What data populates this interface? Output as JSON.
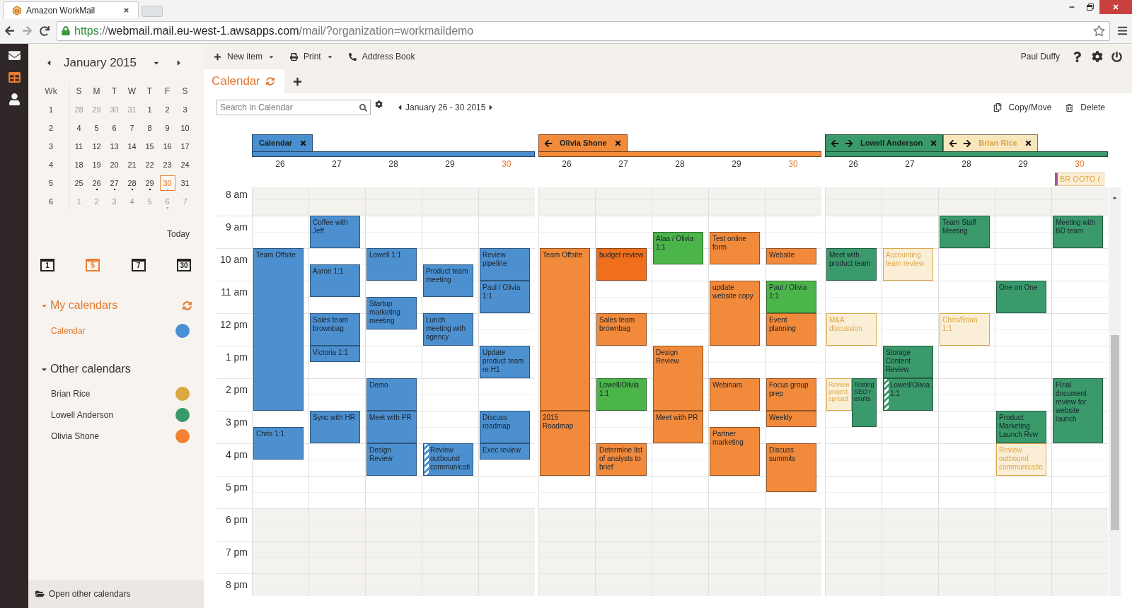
{
  "browser": {
    "tab_title": "Amazon WorkMail",
    "url": {
      "scheme": "https",
      "separator": "://",
      "host": "webmail.mail.eu-west-1.awsapps.com",
      "path": "/mail/?organization=workmaildemo"
    }
  },
  "rail": [
    {
      "selected": false
    },
    {
      "selected": true
    },
    {
      "selected": false
    }
  ],
  "mini_calendar": {
    "title": "January 2015",
    "week_heading": "Wk",
    "weekdays": [
      "S",
      "M",
      "T",
      "W",
      "T",
      "F",
      "S"
    ],
    "weeks": [
      {
        "number": "1",
        "days": [
          {
            "label": "28",
            "muted": true,
            "dot": false,
            "today": false
          },
          {
            "label": "29",
            "muted": true,
            "dot": false,
            "today": false
          },
          {
            "label": "30",
            "muted": true,
            "dot": false,
            "today": false
          },
          {
            "label": "31",
            "muted": true,
            "dot": false,
            "today": false
          },
          {
            "label": "1",
            "muted": false,
            "dot": false,
            "today": false
          },
          {
            "label": "2",
            "muted": false,
            "dot": false,
            "today": false
          },
          {
            "label": "3",
            "muted": false,
            "dot": false,
            "today": false
          }
        ]
      },
      {
        "number": "2",
        "days": [
          {
            "label": "4",
            "muted": false,
            "dot": false,
            "today": false
          },
          {
            "label": "5",
            "muted": false,
            "dot": false,
            "today": false
          },
          {
            "label": "6",
            "muted": false,
            "dot": false,
            "today": false
          },
          {
            "label": "7",
            "muted": false,
            "dot": false,
            "today": false
          },
          {
            "label": "8",
            "muted": false,
            "dot": false,
            "today": false
          },
          {
            "label": "9",
            "muted": false,
            "dot": false,
            "today": false
          },
          {
            "label": "10",
            "muted": false,
            "dot": false,
            "today": false
          }
        ]
      },
      {
        "number": "3",
        "days": [
          {
            "label": "11",
            "muted": false,
            "dot": false,
            "today": false
          },
          {
            "label": "12",
            "muted": false,
            "dot": false,
            "today": false
          },
          {
            "label": "13",
            "muted": false,
            "dot": false,
            "today": false
          },
          {
            "label": "14",
            "muted": false,
            "dot": false,
            "today": false
          },
          {
            "label": "15",
            "muted": false,
            "dot": false,
            "today": false
          },
          {
            "label": "16",
            "muted": false,
            "dot": false,
            "today": false
          },
          {
            "label": "17",
            "muted": false,
            "dot": false,
            "today": false
          }
        ]
      },
      {
        "number": "4",
        "days": [
          {
            "label": "18",
            "muted": false,
            "dot": false,
            "today": false
          },
          {
            "label": "19",
            "muted": false,
            "dot": false,
            "today": false
          },
          {
            "label": "20",
            "muted": false,
            "dot": false,
            "today": false
          },
          {
            "label": "21",
            "muted": false,
            "dot": false,
            "today": false
          },
          {
            "label": "22",
            "muted": false,
            "dot": false,
            "today": false
          },
          {
            "label": "23",
            "muted": false,
            "dot": false,
            "today": false
          },
          {
            "label": "24",
            "muted": false,
            "dot": false,
            "today": false
          }
        ]
      },
      {
        "number": "5",
        "days": [
          {
            "label": "25",
            "muted": false,
            "dot": false,
            "today": false
          },
          {
            "label": "26",
            "muted": false,
            "dot": true,
            "today": false
          },
          {
            "label": "27",
            "muted": false,
            "dot": true,
            "today": false
          },
          {
            "label": "28",
            "muted": false,
            "dot": true,
            "today": false
          },
          {
            "label": "29",
            "muted": false,
            "dot": true,
            "today": false
          },
          {
            "label": "30",
            "muted": false,
            "dot": true,
            "today": true
          },
          {
            "label": "31",
            "muted": false,
            "dot": false,
            "today": false
          }
        ]
      },
      {
        "number": "6",
        "days": [
          {
            "label": "1",
            "muted": true,
            "dot": false,
            "today": false
          },
          {
            "label": "2",
            "muted": true,
            "dot": false,
            "today": false
          },
          {
            "label": "3",
            "muted": true,
            "dot": false,
            "today": false
          },
          {
            "label": "4",
            "muted": true,
            "dot": false,
            "today": false
          },
          {
            "label": "5",
            "muted": true,
            "dot": false,
            "today": false
          },
          {
            "label": "6",
            "muted": true,
            "dot": true,
            "today": false
          },
          {
            "label": "7",
            "muted": true,
            "dot": false,
            "today": false
          }
        ]
      }
    ]
  },
  "today_link": "Today",
  "views": [
    {
      "label": "1",
      "selected": false
    },
    {
      "label": "5",
      "selected": true
    },
    {
      "label": "7",
      "selected": false
    },
    {
      "label": "30",
      "selected": false
    }
  ],
  "my_calendars": {
    "title": "My calendars",
    "expanded": true,
    "items": [
      {
        "name": "Calendar",
        "color": "#4a90d4",
        "selected": true
      }
    ]
  },
  "other_calendars": {
    "title": "Other calendars",
    "expanded": true,
    "items": [
      {
        "name": "Brian Rice",
        "color": "#d9a83e",
        "selected": false
      },
      {
        "name": "Lowell Anderson",
        "color": "#38996a",
        "selected": false
      },
      {
        "name": "Olivia Shone",
        "color": "#f58232",
        "selected": false
      }
    ]
  },
  "open_other": "Open other calendars",
  "toolbar": [
    {
      "label": "New item",
      "dropdown": true
    },
    {
      "label": "Print",
      "dropdown": true
    },
    {
      "label": "Address Book",
      "dropdown": false
    }
  ],
  "user": "Paul Duffy",
  "view_tab": "Calendar",
  "search": {
    "placeholder": "Search in Calendar"
  },
  "date_range": "January 26 - 30 2015",
  "actions": [
    "Copy/Move",
    "Delete"
  ],
  "hours": [
    "8 am",
    "9 am",
    "10 am",
    "11 am",
    "12 pm",
    "1 pm",
    "2 pm",
    "3 pm",
    "4 pm",
    "5 pm",
    "6 pm",
    "7 pm",
    "8 pm"
  ],
  "groups": [
    {
      "color": "#4a8fd0",
      "tabs": [
        {
          "name": "Calendar",
          "kind": "plain",
          "color": "#4a8fd0"
        }
      ],
      "days": [
        {
          "label": "26",
          "today": false,
          "slots": [
            {
              "kind": "off"
            },
            {
              "kind": "off"
            },
            {
              "kind": "open"
            },
            {
              "kind": "open"
            },
            {
              "kind": "busy",
              "title": "Team Offsite",
              "color": "#4d90d0"
            },
            {
              "kind": "continued"
            },
            {
              "kind": "continued"
            },
            {
              "kind": "continued"
            },
            {
              "kind": "continued"
            },
            {
              "kind": "continued"
            },
            {
              "kind": "continued"
            },
            {
              "kind": "continued"
            },
            {
              "kind": "continued"
            },
            {
              "kind": "continued"
            },
            {
              "kind": "open"
            },
            {
              "kind": "busy",
              "title": "Chris 1:1",
              "color": "#4d90d0"
            },
            {
              "kind": "continued"
            },
            {
              "kind": "open"
            },
            {
              "kind": "open"
            },
            {
              "kind": "open"
            },
            {
              "kind": "off"
            },
            {
              "kind": "off"
            },
            {
              "kind": "off"
            },
            {
              "kind": "off"
            },
            {
              "kind": "off"
            },
            {
              "kind": "off"
            }
          ]
        },
        {
          "label": "27",
          "today": false,
          "slots": [
            {
              "kind": "off"
            },
            {
              "kind": "off"
            },
            {
              "kind": "busy",
              "title": "Coffee with Jeff",
              "color": "#4d90d0"
            },
            {
              "kind": "continued"
            },
            {
              "kind": "open"
            },
            {
              "kind": "busy",
              "title": "Aaron 1:1",
              "color": "#4d90d0"
            },
            {
              "kind": "continued"
            },
            {
              "kind": "open"
            },
            {
              "kind": "busy",
              "title": "Sales team brownbag",
              "color": "#4d90d0"
            },
            {
              "kind": "continued"
            },
            {
              "kind": "busy",
              "title": "Victoria 1:1",
              "color": "#4d90d0"
            },
            {
              "kind": "open"
            },
            {
              "kind": "open"
            },
            {
              "kind": "open"
            },
            {
              "kind": "busy",
              "title": "Sync with HR",
              "color": "#4d90d0"
            },
            {
              "kind": "continued"
            },
            {
              "kind": "open"
            },
            {
              "kind": "open"
            },
            {
              "kind": "open"
            },
            {
              "kind": "open"
            },
            {
              "kind": "off"
            },
            {
              "kind": "off"
            },
            {
              "kind": "off"
            },
            {
              "kind": "off"
            },
            {
              "kind": "off"
            },
            {
              "kind": "off"
            }
          ]
        },
        {
          "label": "28",
          "today": false,
          "slots": [
            {
              "kind": "off"
            },
            {
              "kind": "off"
            },
            {
              "kind": "open"
            },
            {
              "kind": "open"
            },
            {
              "kind": "busy",
              "title": "Lowell 1:1",
              "color": "#4d90d0"
            },
            {
              "kind": "continued"
            },
            {
              "kind": "open"
            },
            {
              "kind": "busy",
              "title": "Startup marketing meeting",
              "color": "#4d90d0"
            },
            {
              "kind": "continued"
            },
            {
              "kind": "open"
            },
            {
              "kind": "open"
            },
            {
              "kind": "open"
            },
            {
              "kind": "busy",
              "title": "Demo",
              "color": "#4d90d0"
            },
            {
              "kind": "continued"
            },
            {
              "kind": "busy",
              "title": "Meet with PR",
              "color": "#4d90d0"
            },
            {
              "kind": "continued"
            },
            {
              "kind": "busy",
              "title": "Design Review",
              "color": "#4d90d0"
            },
            {
              "kind": "continued"
            },
            {
              "kind": "open"
            },
            {
              "kind": "open"
            },
            {
              "kind": "off"
            },
            {
              "kind": "off"
            },
            {
              "kind": "off"
            },
            {
              "kind": "off"
            },
            {
              "kind": "off"
            },
            {
              "kind": "off"
            }
          ]
        },
        {
          "label": "29",
          "today": false,
          "slots": [
            {
              "kind": "off"
            },
            {
              "kind": "off"
            },
            {
              "kind": "open"
            },
            {
              "kind": "open"
            },
            {
              "kind": "open"
            },
            {
              "kind": "busy",
              "title": "Product team meeting",
              "color": "#4d90d0"
            },
            {
              "kind": "continued"
            },
            {
              "kind": "open"
            },
            {
              "kind": "busy",
              "title": "Lunch meeting with agency",
              "color": "#4d90d0"
            },
            {
              "kind": "continued"
            },
            {
              "kind": "open"
            },
            {
              "kind": "open"
            },
            {
              "kind": "open"
            },
            {
              "kind": "open"
            },
            {
              "kind": "open"
            },
            {
              "kind": "open"
            },
            {
              "kind": "hatched",
              "title": "Review outbound communicati",
              "color": "#4d90d0"
            },
            {
              "kind": "continued"
            },
            {
              "kind": "open"
            },
            {
              "kind": "open"
            },
            {
              "kind": "off"
            },
            {
              "kind": "off"
            },
            {
              "kind": "off"
            },
            {
              "kind": "off"
            },
            {
              "kind": "off"
            },
            {
              "kind": "off"
            }
          ]
        },
        {
          "label": "30",
          "today": true,
          "slots": [
            {
              "kind": "off"
            },
            {
              "kind": "off"
            },
            {
              "kind": "open"
            },
            {
              "kind": "open"
            },
            {
              "kind": "busy",
              "title": "Review pipeline",
              "color": "#4d90d0"
            },
            {
              "kind": "continued"
            },
            {
              "kind": "busy",
              "title": "Paul / Olivia 1:1",
              "color": "#4d90d0"
            },
            {
              "kind": "continued"
            },
            {
              "kind": "open"
            },
            {
              "kind": "open"
            },
            {
              "kind": "busy",
              "title": "Update product team re:H1",
              "color": "#4d90d0"
            },
            {
              "kind": "continued"
            },
            {
              "kind": "open"
            },
            {
              "kind": "open"
            },
            {
              "kind": "busy",
              "title": "Discuss roadmap",
              "color": "#4d90d0"
            },
            {
              "kind": "continued"
            },
            {
              "kind": "busy",
              "title": "Exec review",
              "color": "#4d90d0"
            },
            {
              "kind": "open"
            },
            {
              "kind": "open"
            },
            {
              "kind": "open"
            },
            {
              "kind": "off"
            },
            {
              "kind": "off"
            },
            {
              "kind": "off"
            },
            {
              "kind": "off"
            },
            {
              "kind": "off"
            },
            {
              "kind": "off"
            }
          ]
        }
      ]
    },
    {
      "color": "#f28a3c",
      "tabs": [
        {
          "name": "Olivia Shone",
          "kind": "back",
          "color": "#f28a3c"
        }
      ],
      "days": [
        {
          "label": "26",
          "today": false,
          "slots": [
            {
              "kind": "off"
            },
            {
              "kind": "off"
            },
            {
              "kind": "open"
            },
            {
              "kind": "open"
            },
            {
              "kind": "busy",
              "title": "Team Offsite",
              "color": "#f28a3c"
            },
            {
              "kind": "continued"
            },
            {
              "kind": "continued"
            },
            {
              "kind": "continued"
            },
            {
              "kind": "continued"
            },
            {
              "kind": "continued"
            },
            {
              "kind": "continued"
            },
            {
              "kind": "continued"
            },
            {
              "kind": "continued"
            },
            {
              "kind": "continued"
            },
            {
              "kind": "busy",
              "title": "2015 Roadmap",
              "color": "#f28a3c"
            },
            {
              "kind": "continued"
            },
            {
              "kind": "continued"
            },
            {
              "kind": "continued"
            },
            {
              "kind": "open"
            },
            {
              "kind": "open"
            },
            {
              "kind": "off"
            },
            {
              "kind": "off"
            },
            {
              "kind": "off"
            },
            {
              "kind": "off"
            },
            {
              "kind": "off"
            },
            {
              "kind": "off"
            }
          ]
        },
        {
          "label": "27",
          "today": false,
          "slots": [
            {
              "kind": "off"
            },
            {
              "kind": "off"
            },
            {
              "kind": "open"
            },
            {
              "kind": "open"
            },
            {
              "kind": "busy",
              "title": "budget review",
              "color": "#ef6f1c"
            },
            {
              "kind": "continued"
            },
            {
              "kind": "open"
            },
            {
              "kind": "open"
            },
            {
              "kind": "busy",
              "title": "Sales team brownbag",
              "color": "#f28a3c"
            },
            {
              "kind": "continued"
            },
            {
              "kind": "open"
            },
            {
              "kind": "open"
            },
            {
              "kind": "busy",
              "title": "Lowell/Olivia 1:1",
              "color": "#4cb54a"
            },
            {
              "kind": "continued"
            },
            {
              "kind": "open"
            },
            {
              "kind": "open"
            },
            {
              "kind": "busy",
              "title": "Determine list of analysts to brief",
              "color": "#f28a3c"
            },
            {
              "kind": "continued"
            },
            {
              "kind": "open"
            },
            {
              "kind": "open"
            },
            {
              "kind": "off"
            },
            {
              "kind": "off"
            },
            {
              "kind": "off"
            },
            {
              "kind": "off"
            },
            {
              "kind": "off"
            },
            {
              "kind": "off"
            }
          ]
        },
        {
          "label": "28",
          "today": false,
          "slots": [
            {
              "kind": "off"
            },
            {
              "kind": "off"
            },
            {
              "kind": "open"
            },
            {
              "kind": "busy",
              "title": "Alaa / Olivia 1:1",
              "color": "#4cb54a"
            },
            {
              "kind": "continued"
            },
            {
              "kind": "open"
            },
            {
              "kind": "open"
            },
            {
              "kind": "open"
            },
            {
              "kind": "open"
            },
            {
              "kind": "open"
            },
            {
              "kind": "busy",
              "title": "Design Review",
              "color": "#f28a3c"
            },
            {
              "kind": "continued"
            },
            {
              "kind": "continued"
            },
            {
              "kind": "continued"
            },
            {
              "kind": "busy",
              "title": "Meet with PR",
              "color": "#f28a3c"
            },
            {
              "kind": "continued"
            },
            {
              "kind": "open"
            },
            {
              "kind": "open"
            },
            {
              "kind": "open"
            },
            {
              "kind": "open"
            },
            {
              "kind": "off"
            },
            {
              "kind": "off"
            },
            {
              "kind": "off"
            },
            {
              "kind": "off"
            },
            {
              "kind": "off"
            },
            {
              "kind": "off"
            }
          ]
        },
        {
          "label": "29",
          "today": false,
          "slots": [
            {
              "kind": "off"
            },
            {
              "kind": "off"
            },
            {
              "kind": "open"
            },
            {
              "kind": "busy",
              "title": "Test online form",
              "color": "#f28a3c"
            },
            {
              "kind": "continued"
            },
            {
              "kind": "open"
            },
            {
              "kind": "busy",
              "title": "update website copy",
              "color": "#f28a3c"
            },
            {
              "kind": "continued"
            },
            {
              "kind": "continued"
            },
            {
              "kind": "continued"
            },
            {
              "kind": "open"
            },
            {
              "kind": "open"
            },
            {
              "kind": "busy",
              "title": "Webinars",
              "color": "#f28a3c"
            },
            {
              "kind": "continued"
            },
            {
              "kind": "open"
            },
            {
              "kind": "busy",
              "title": "Partner marketing",
              "color": "#f28a3c"
            },
            {
              "kind": "continued"
            },
            {
              "kind": "continued"
            },
            {
              "kind": "open"
            },
            {
              "kind": "open"
            },
            {
              "kind": "off"
            },
            {
              "kind": "off"
            },
            {
              "kind": "off"
            },
            {
              "kind": "off"
            },
            {
              "kind": "off"
            },
            {
              "kind": "off"
            }
          ]
        },
        {
          "label": "30",
          "today": true,
          "slots": [
            {
              "kind": "off"
            },
            {
              "kind": "off"
            },
            {
              "kind": "open"
            },
            {
              "kind": "open"
            },
            {
              "kind": "busy",
              "title": "Website",
              "color": "#f28a3c"
            },
            {
              "kind": "open"
            },
            {
              "kind": "busy",
              "title": "Paul / Olivia 1:1",
              "color": "#4cb54a"
            },
            {
              "kind": "continued"
            },
            {
              "kind": "busy",
              "title": "Event planning",
              "color": "#f28a3c"
            },
            {
              "kind": "continued"
            },
            {
              "kind": "open"
            },
            {
              "kind": "open"
            },
            {
              "kind": "busy",
              "title": "Focus group prep",
              "color": "#f28a3c"
            },
            {
              "kind": "continued"
            },
            {
              "kind": "busy",
              "title": "Weekly",
              "color": "#f28a3c"
            },
            {
              "kind": "open"
            },
            {
              "kind": "busy",
              "title": "Discuss summits",
              "color": "#f28a3c"
            },
            {
              "kind": "continued"
            },
            {
              "kind": "continued"
            },
            {
              "kind": "open"
            },
            {
              "kind": "off"
            },
            {
              "kind": "off"
            },
            {
              "kind": "off"
            },
            {
              "kind": "off"
            },
            {
              "kind": "off"
            },
            {
              "kind": "off"
            }
          ]
        }
      ]
    },
    {
      "color": "#3a9a6b",
      "tabs": [
        {
          "name": "Lowell Anderson",
          "kind": "movable",
          "color": "#3a9a6b"
        },
        {
          "name": "Brian Rice",
          "kind": "movable",
          "color": "#f8e6bd"
        }
      ],
      "days": [
        {
          "label": "26",
          "today": false,
          "slots": [
            {
              "kind": "off"
            },
            {
              "kind": "off"
            },
            {
              "kind": "open"
            },
            {
              "kind": "open"
            },
            {
              "kind": "busy",
              "title": "Meet with product team",
              "color": "#3a9a6b"
            },
            {
              "kind": "continued"
            },
            {
              "kind": "open"
            },
            {
              "kind": "open"
            },
            {
              "kind": "tentative",
              "title": "M&A discussion",
              "color": "#d9a84b"
            },
            {
              "kind": "continued"
            },
            {
              "kind": "open"
            },
            {
              "kind": "open"
            },
            {
              "kind": "split",
              "lanes": [
                {
                  "kind": "tentative",
                  "title": "Review project spread",
                  "color": "#d9a84b"
                },
                {
                  "kind": "busy",
                  "title": "Testing SEO results",
                  "color": "#3a9a6b"
                }
              ]
            },
            {
              "kind": "split",
              "lanes": [
                {
                  "kind": "continued"
                },
                {
                  "kind": "continued"
                }
              ]
            },
            {
              "kind": "split",
              "lanes": [
                {
                  "kind": "open"
                },
                {
                  "kind": "continued"
                }
              ]
            },
            {
              "kind": "open"
            },
            {
              "kind": "open"
            },
            {
              "kind": "open"
            },
            {
              "kind": "open"
            },
            {
              "kind": "open"
            },
            {
              "kind": "off"
            },
            {
              "kind": "off"
            },
            {
              "kind": "off"
            },
            {
              "kind": "off"
            },
            {
              "kind": "off"
            },
            {
              "kind": "off"
            }
          ]
        },
        {
          "label": "27",
          "today": false,
          "slots": [
            {
              "kind": "off"
            },
            {
              "kind": "off"
            },
            {
              "kind": "open"
            },
            {
              "kind": "open"
            },
            {
              "kind": "tentative",
              "title": "Accounting team review",
              "color": "#d9a84b"
            },
            {
              "kind": "continued"
            },
            {
              "kind": "open"
            },
            {
              "kind": "open"
            },
            {
              "kind": "open"
            },
            {
              "kind": "open"
            },
            {
              "kind": "busy",
              "title": "Storage Content Review",
              "color": "#3a9a6b"
            },
            {
              "kind": "continued"
            },
            {
              "kind": "hatched",
              "title": "Lowell/Olivia 1:1",
              "color": "#3a9a6b"
            },
            {
              "kind": "continued"
            },
            {
              "kind": "open"
            },
            {
              "kind": "open"
            },
            {
              "kind": "open"
            },
            {
              "kind": "open"
            },
            {
              "kind": "open"
            },
            {
              "kind": "open"
            },
            {
              "kind": "off"
            },
            {
              "kind": "off"
            },
            {
              "kind": "off"
            },
            {
              "kind": "off"
            },
            {
              "kind": "off"
            },
            {
              "kind": "off"
            }
          ]
        },
        {
          "label": "28",
          "today": false,
          "slots": [
            {
              "kind": "off"
            },
            {
              "kind": "off"
            },
            {
              "kind": "busy",
              "title": "Team Staff Meeting",
              "color": "#3a9a6b"
            },
            {
              "kind": "continued"
            },
            {
              "kind": "open"
            },
            {
              "kind": "open"
            },
            {
              "kind": "open"
            },
            {
              "kind": "open"
            },
            {
              "kind": "tentative",
              "title": "Chris/Brian 1:1",
              "color": "#d9a84b"
            },
            {
              "kind": "continued"
            },
            {
              "kind": "open"
            },
            {
              "kind": "open"
            },
            {
              "kind": "open"
            },
            {
              "kind": "open"
            },
            {
              "kind": "open"
            },
            {
              "kind": "open"
            },
            {
              "kind": "open"
            },
            {
              "kind": "open"
            },
            {
              "kind": "open"
            },
            {
              "kind": "open"
            },
            {
              "kind": "off"
            },
            {
              "kind": "off"
            },
            {
              "kind": "off"
            },
            {
              "kind": "off"
            },
            {
              "kind": "off"
            },
            {
              "kind": "off"
            }
          ]
        },
        {
          "label": "29",
          "today": false,
          "slots": [
            {
              "kind": "off"
            },
            {
              "kind": "off"
            },
            {
              "kind": "open"
            },
            {
              "kind": "open"
            },
            {
              "kind": "open"
            },
            {
              "kind": "open"
            },
            {
              "kind": "busy",
              "title": "One on One",
              "color": "#3a9a6b"
            },
            {
              "kind": "continued"
            },
            {
              "kind": "open"
            },
            {
              "kind": "open"
            },
            {
              "kind": "open"
            },
            {
              "kind": "open"
            },
            {
              "kind": "open"
            },
            {
              "kind": "open"
            },
            {
              "kind": "busy",
              "title": "Product Marketing Launch Rvw",
              "color": "#3a9a6b"
            },
            {
              "kind": "continued"
            },
            {
              "kind": "tentative",
              "title": "Review outbound communicatio",
              "color": "#d9a84b"
            },
            {
              "kind": "continued"
            },
            {
              "kind": "open"
            },
            {
              "kind": "open"
            },
            {
              "kind": "off"
            },
            {
              "kind": "off"
            },
            {
              "kind": "off"
            },
            {
              "kind": "off"
            },
            {
              "kind": "off"
            },
            {
              "kind": "off"
            }
          ]
        },
        {
          "label": "30",
          "today": true,
          "all_day": [
            {
              "title": "BR OOTO ("
            }
          ],
          "slots": [
            {
              "kind": "off"
            },
            {
              "kind": "off"
            },
            {
              "kind": "busy",
              "title": "Meeting with BD team",
              "color": "#3a9a6b"
            },
            {
              "kind": "continued"
            },
            {
              "kind": "open"
            },
            {
              "kind": "open"
            },
            {
              "kind": "open"
            },
            {
              "kind": "open"
            },
            {
              "kind": "open"
            },
            {
              "kind": "open"
            },
            {
              "kind": "open"
            },
            {
              "kind": "open"
            },
            {
              "kind": "busy",
              "title": "FInal document review for website launch",
              "color": "#3a9a6b"
            },
            {
              "kind": "continued"
            },
            {
              "kind": "continued"
            },
            {
              "kind": "continued"
            },
            {
              "kind": "open"
            },
            {
              "kind": "open"
            },
            {
              "kind": "open"
            },
            {
              "kind": "open"
            },
            {
              "kind": "off"
            },
            {
              "kind": "off"
            },
            {
              "kind": "off"
            },
            {
              "kind": "off"
            },
            {
              "kind": "off"
            },
            {
              "kind": "off"
            }
          ]
        }
      ]
    }
  ]
}
